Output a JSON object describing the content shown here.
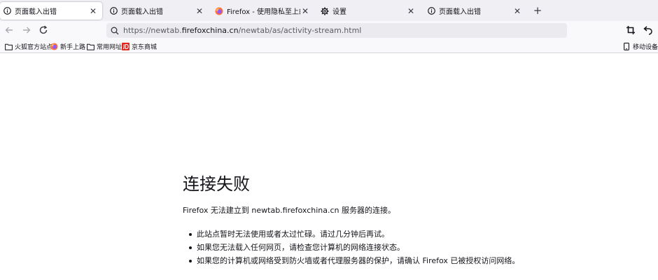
{
  "tabs": [
    {
      "label": "页面载入出错",
      "icon": "info-icon",
      "active": true
    },
    {
      "label": "页面载入出错",
      "icon": "info-icon",
      "active": false
    },
    {
      "label": "Firefox - 使用隐私至上的产品保护",
      "icon": "firefox-logo-icon",
      "active": false
    },
    {
      "label": "设置",
      "icon": "gear-icon",
      "active": false
    },
    {
      "label": "页面载入出错",
      "icon": "info-icon",
      "active": false
    }
  ],
  "new_tab_label": "+",
  "url": {
    "prefix": "https://newtab.",
    "domain": "firefoxchina.cn",
    "suffix": "/newtab/as/activity-stream.html"
  },
  "bookmarks": [
    {
      "label": "火狐官方站点",
      "icon": "folder-icon"
    },
    {
      "label": "新手上路",
      "icon": "firefox-logo-icon"
    },
    {
      "label": "常用网址",
      "icon": "folder-icon"
    },
    {
      "label": "京东商城",
      "icon": "jd-logo-icon"
    }
  ],
  "mobile_bookmarks_label": "移动设备上的书签",
  "error": {
    "title": "连接失败",
    "description": "Firefox 无法建立到 newtab.firefoxchina.cn 服务器的连接。",
    "items": [
      "此站点暂时无法使用或者太过忙碌。请过几分钟后再试。",
      "如果您无法载入任何网页，请检查您计算机的网络连接状态。",
      "如果您的计算机或网络受到防火墙或者代理服务器的保护，请确认 Firefox 已被授权访问网络。"
    ]
  },
  "colors": {
    "tabstrip_bg": "#f0f0f4",
    "toolbar_bg": "#f9f9fb",
    "urlbar_bg": "#ebebef",
    "text": "#15141a",
    "jd_red": "#e1251b"
  }
}
